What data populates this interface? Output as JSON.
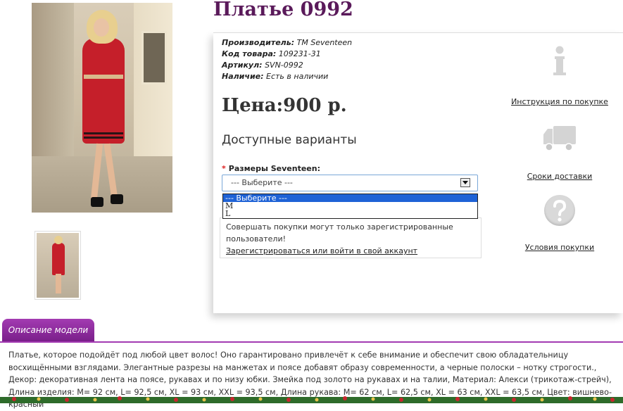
{
  "product": {
    "title": "Платье 0992",
    "specs": [
      {
        "label": "Производитель:",
        "value": "ТМ Seventeen"
      },
      {
        "label": "Код товара:",
        "value": "109231-31"
      },
      {
        "label": "Артикул:",
        "value": "SVN-0992"
      },
      {
        "label": "Наличие:",
        "value": "Есть в наличии"
      }
    ],
    "price": "Цена:900 р.",
    "variants_heading": "Доступные варианты",
    "sizes_label": "Размеры Seventeen:",
    "select_value": "--- Выберите ---",
    "select_options": [
      "--- Выберите ---",
      "M",
      "L"
    ],
    "notice_text": "Совершать покупки могут только зарегистрированные пользователи!",
    "notice_link": "Зарегистрироваться или войти в свой аккаунт"
  },
  "sidebar": {
    "items": [
      {
        "label": "Инструкция по покупке",
        "icon": "info-icon"
      },
      {
        "label": "Сроки доставки",
        "icon": "truck-icon"
      },
      {
        "label": "Условия покупки",
        "icon": "question-icon"
      }
    ]
  },
  "description": {
    "tab_label": "Описание модели",
    "text": "Платье, которое подойдёт под любой цвет волос! Оно гарантировано привлечёт к себе внимание и обеспечит свою обладательницу восхищёнными взглядами. Элегантные разрезы на манжетах и поясе добавят образу современности, а черные полоски – нотку строгости., Декор: декоративная лента на поясе, рукавах и по низу юбки. Змейка под золото на рукавах и на талии, Материал: Алекси (трикотаж-стрейч), Длина изделия: M= 92 см, L= 92,5 см, XL = 93 см, XXL = 93,5 см, Длина рукава: M= 62 см, L= 62,5 см, XL = 63 см, XXL = 63,5 см, Цвет: вишнево-красный"
  },
  "colors": {
    "title": "#5a1a5a",
    "tab": "#8e2a9e",
    "select_highlight": "#1e62d6",
    "dress": "#c51f2a"
  }
}
